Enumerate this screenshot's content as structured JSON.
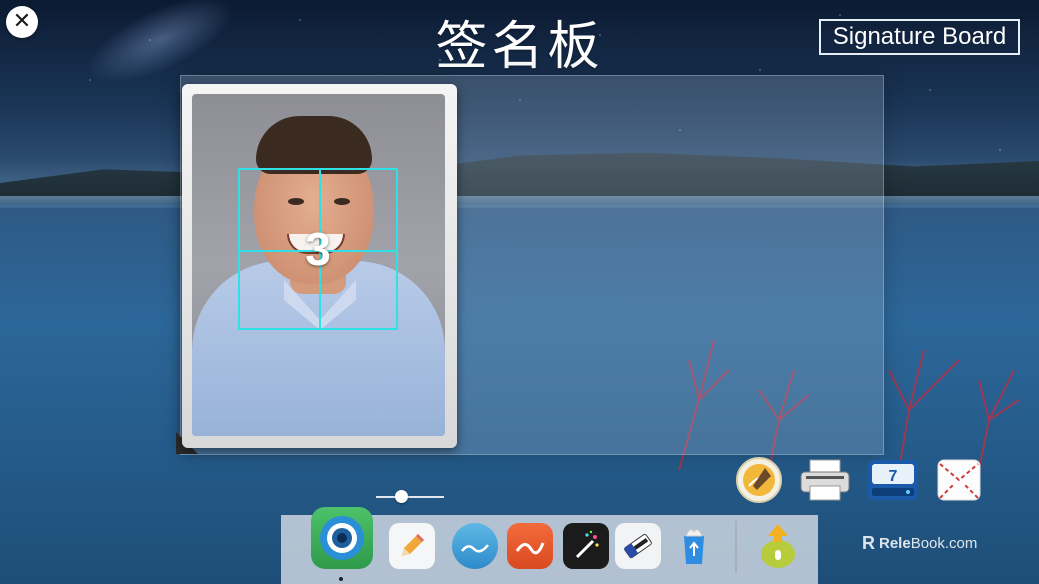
{
  "app": {
    "title": "签名板",
    "subtitle_button": "Signature Board"
  },
  "toolbar": {
    "close_icon": "close-icon"
  },
  "camera": {
    "countdown": "3",
    "focus_color": "#2fe0e6"
  },
  "slider": {
    "value_fraction": 0.35
  },
  "dock": {
    "items": [
      {
        "name": "camera",
        "icon": "camera-icon",
        "active": true
      },
      {
        "name": "pencil",
        "icon": "pencil-icon"
      },
      {
        "name": "pen-stroke",
        "icon": "pen-stroke-icon"
      },
      {
        "name": "brush-stroke",
        "icon": "brush-stroke-icon"
      },
      {
        "name": "magic-wand",
        "icon": "magic-wand-icon"
      },
      {
        "name": "eraser",
        "icon": "eraser-icon"
      },
      {
        "name": "trash",
        "icon": "trash-icon"
      },
      {
        "name": "upload",
        "icon": "upload-icon"
      }
    ]
  },
  "tools": [
    {
      "name": "stamp",
      "icon": "stamp-icon"
    },
    {
      "name": "printer",
      "icon": "printer-icon"
    },
    {
      "name": "save-drive",
      "icon": "save-drive-icon",
      "label": "7"
    },
    {
      "name": "envelope",
      "icon": "envelope-icon"
    }
  ],
  "watermark": {
    "logo": "R",
    "brand_bold": "Rele",
    "brand_rest": "Book.com"
  }
}
